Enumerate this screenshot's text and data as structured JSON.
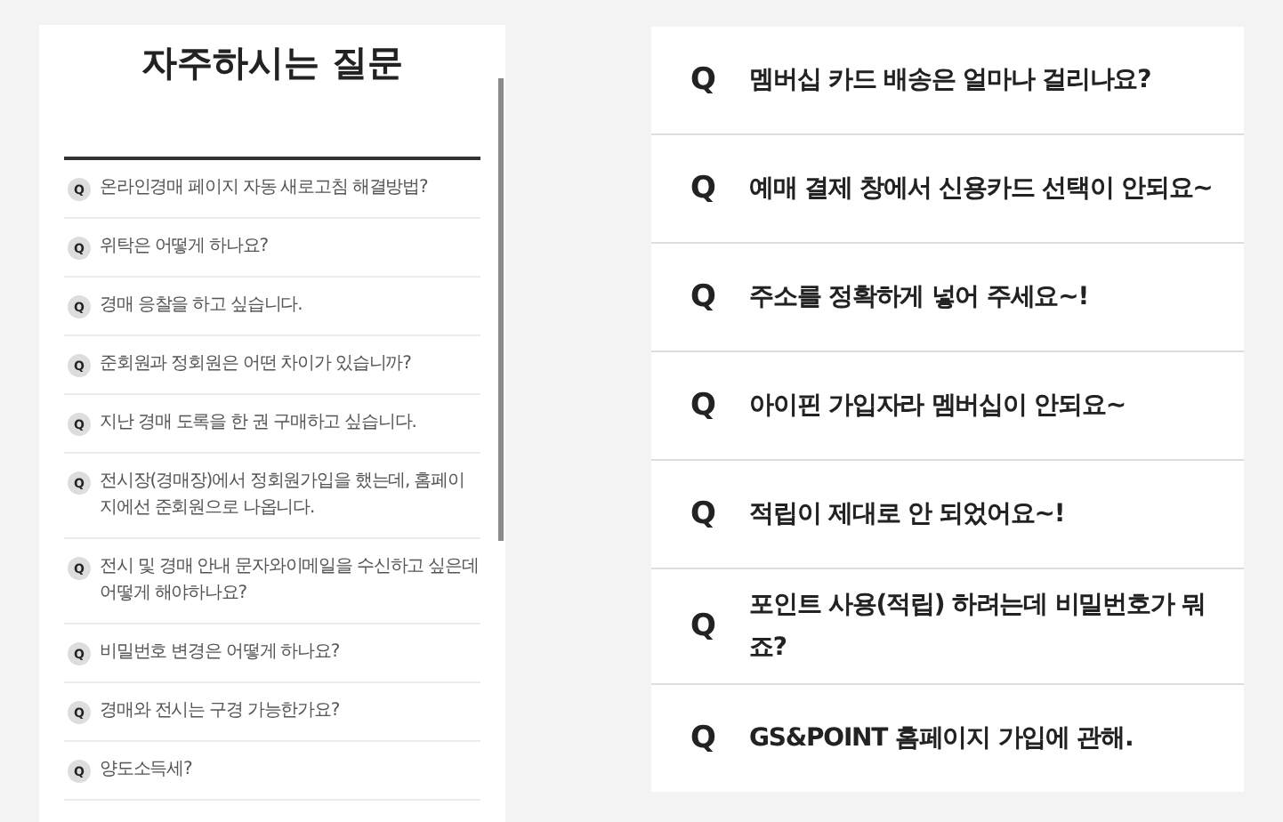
{
  "left_panel": {
    "title": "자주하시는 질문",
    "items": [
      {
        "badge": "Q",
        "text": "온라인경매 페이지 자동 새로고침 해결방법?"
      },
      {
        "badge": "Q",
        "text": "위탁은 어떻게 하나요?"
      },
      {
        "badge": "Q",
        "text": "경매 응찰을 하고 싶습니다."
      },
      {
        "badge": "Q",
        "text": "준회원과 정회원은 어떤 차이가 있습니까?"
      },
      {
        "badge": "Q",
        "text": "지난 경매 도록을 한 권 구매하고 싶습니다."
      },
      {
        "badge": "Q",
        "text": "전시장(경매장)에서 정회원가입을 했는데, 홈페이지에선 준회원으로 나옵니다."
      },
      {
        "badge": "Q",
        "text": "전시 및 경매 안내 문자와이메일을 수신하고 싶은데 어떻게 해야하나요?"
      },
      {
        "badge": "Q",
        "text": "비밀번호 변경은 어떻게 하나요?"
      },
      {
        "badge": "Q",
        "text": "경매와 전시는 구경 가능한가요?"
      },
      {
        "badge": "Q",
        "text": "양도소득세?"
      }
    ]
  },
  "right_panel": {
    "items": [
      {
        "badge": "Q",
        "text": "멤버십 카드 배송은 얼마나 걸리나요?"
      },
      {
        "badge": "Q",
        "text": "예매 결제 창에서 신용카드 선택이 안되요~"
      },
      {
        "badge": "Q",
        "text": "주소를 정확하게 넣어 주세요~!"
      },
      {
        "badge": "Q",
        "text": "아이핀 가입자라 멤버십이 안되요~"
      },
      {
        "badge": "Q",
        "text": "적립이 제대로 안 되었어요~!"
      },
      {
        "badge": "Q",
        "text": "포인트 사용(적립) 하려는데 비밀번호가 뭐죠?"
      },
      {
        "badge": "Q",
        "text": "GS&POINT 홈페이지 가입에 관해."
      }
    ]
  }
}
